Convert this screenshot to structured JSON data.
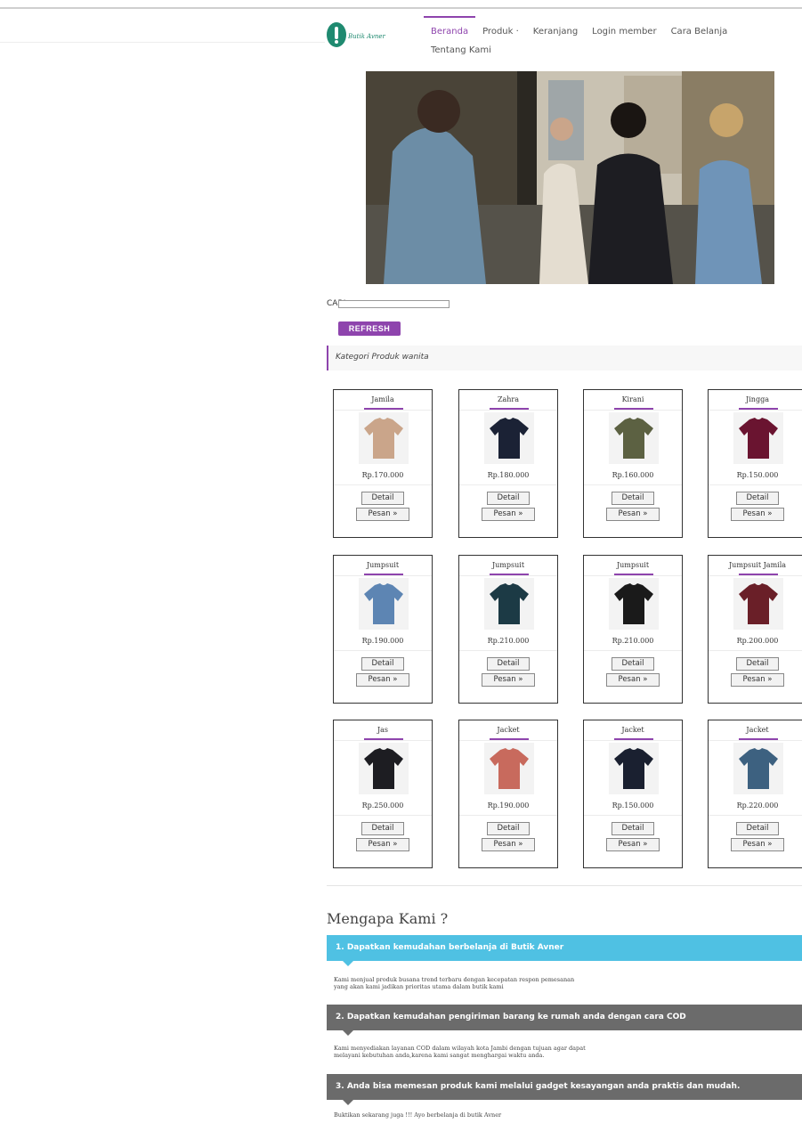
{
  "brand": {
    "logo_text": "Butik Avner"
  },
  "nav": {
    "items": [
      "Beranda",
      "Produk ·",
      "Keranjang",
      "Login member",
      "Cara Belanja"
    ],
    "second_row": [
      "Tentang Kami"
    ]
  },
  "hero": {
    "alt": "Fashion photo of four people in a city street"
  },
  "search": {
    "label": "CARI :",
    "value": ""
  },
  "refresh_label": "REFRESH",
  "category_title": "Kategori Produk wanita",
  "button_detail": "Detail",
  "button_pesan": "Pesan »",
  "products": [
    {
      "name": "Jamila",
      "price": "Rp.170.000",
      "color": "#caa58a"
    },
    {
      "name": "Zahra",
      "price": "Rp.180.000",
      "color": "#1b2235"
    },
    {
      "name": "Kirani",
      "price": "Rp.160.000",
      "color": "#5c6142"
    },
    {
      "name": "Jingga",
      "price": "Rp.150.000",
      "color": "#6a1430"
    },
    {
      "name": "Jumpsuit",
      "price": "Rp.190.000",
      "color": "#5d85b3"
    },
    {
      "name": "Jumpsuit",
      "price": "Rp.210.000",
      "color": "#1c3a45"
    },
    {
      "name": "Jumpsuit",
      "price": "Rp.210.000",
      "color": "#1a1a1a"
    },
    {
      "name": "Jumpsuit Jamila",
      "price": "Rp.200.000",
      "color": "#6a1f28"
    },
    {
      "name": "Jas",
      "price": "Rp.250.000",
      "color": "#1d1d22"
    },
    {
      "name": "Jacket",
      "price": "Rp.190.000",
      "color": "#c86a5d"
    },
    {
      "name": "Jacket",
      "price": "Rp.150.000",
      "color": "#1a2030"
    },
    {
      "name": "Jacket",
      "price": "Rp.220.000",
      "color": "#3d6180"
    }
  ],
  "why": {
    "title": "Mengapa Kami ?",
    "items": [
      {
        "heading": "1. Dapatkan kemudahan berbelanja di Butik Avner",
        "body": "Kami menjual produk busana trend terbaru dengan kecepatan respon pemesanan\nyang akan kami jadikan prioritas utama dalam butik kami"
      },
      {
        "heading": "2. Dapatkan kemudahan pengiriman barang ke rumah anda dengan cara COD",
        "body": "Kami menyediakan layanan COD dalam wilayah kota Jambi dengan tujuan agar dapat\nmelayani kebutuhan anda,karena kami sangat menghargai waktu anda."
      },
      {
        "heading": "3. Anda bisa memesan produk kami melalui gadget kesayangan anda praktis dan mudah.",
        "body": "Buktikan sekarang juga !!! Ayo berbelanja di butik Avner"
      }
    ]
  },
  "colors": {
    "accent": "#8e44ad",
    "why_blue": "#4fc1e3",
    "why_gray": "#6b6b6b",
    "logo": "#1f8a70"
  }
}
